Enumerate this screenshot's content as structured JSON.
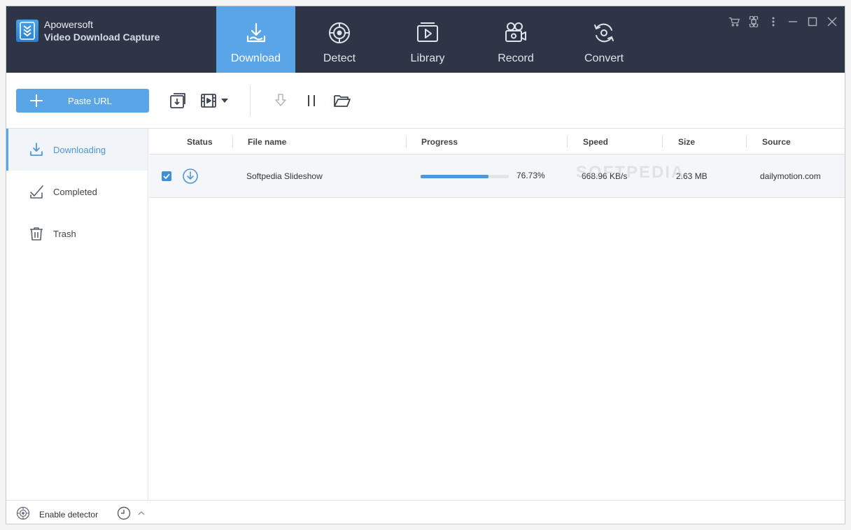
{
  "app": {
    "brand_line1": "Apowersoft",
    "brand_line2": "Video Download Capture"
  },
  "tabs": [
    {
      "label": "Download",
      "icon": "download-icon",
      "active": true
    },
    {
      "label": "Detect",
      "icon": "detect-icon",
      "active": false
    },
    {
      "label": "Library",
      "icon": "library-icon",
      "active": false
    },
    {
      "label": "Record",
      "icon": "record-icon",
      "active": false
    },
    {
      "label": "Convert",
      "icon": "convert-icon",
      "active": false
    }
  ],
  "window_controls": [
    "cart-icon",
    "command-icon",
    "more-icon",
    "minimize-icon",
    "maximize-icon",
    "close-icon"
  ],
  "toolbar": {
    "paste_label": "Paste URL",
    "icons": [
      "batch-download-icon",
      "video-format-icon",
      "resume-icon",
      "pause-icon",
      "open-folder-icon"
    ]
  },
  "sidebar": {
    "items": [
      {
        "label": "Downloading",
        "icon": "downloading-icon",
        "active": true
      },
      {
        "label": "Completed",
        "icon": "completed-icon",
        "active": false
      },
      {
        "label": "Trash",
        "icon": "trash-icon",
        "active": false
      }
    ]
  },
  "table": {
    "columns": [
      "Status",
      "File name",
      "Progress",
      "Speed",
      "Size",
      "Source"
    ],
    "rows": [
      {
        "checked": true,
        "file_name": "Softpedia Slideshow",
        "progress_text": "76.73%",
        "progress_value": 76.73,
        "speed": "668.96 KB/s",
        "size": "2.63 MB",
        "source": "dailymotion.com"
      }
    ]
  },
  "watermark": "SOFTPEDIA",
  "statusbar": {
    "detector_label": "Enable detector"
  },
  "colors": {
    "header_bg": "#2e3546",
    "accent": "#5aa5e8",
    "progress": "#4f97d9"
  }
}
